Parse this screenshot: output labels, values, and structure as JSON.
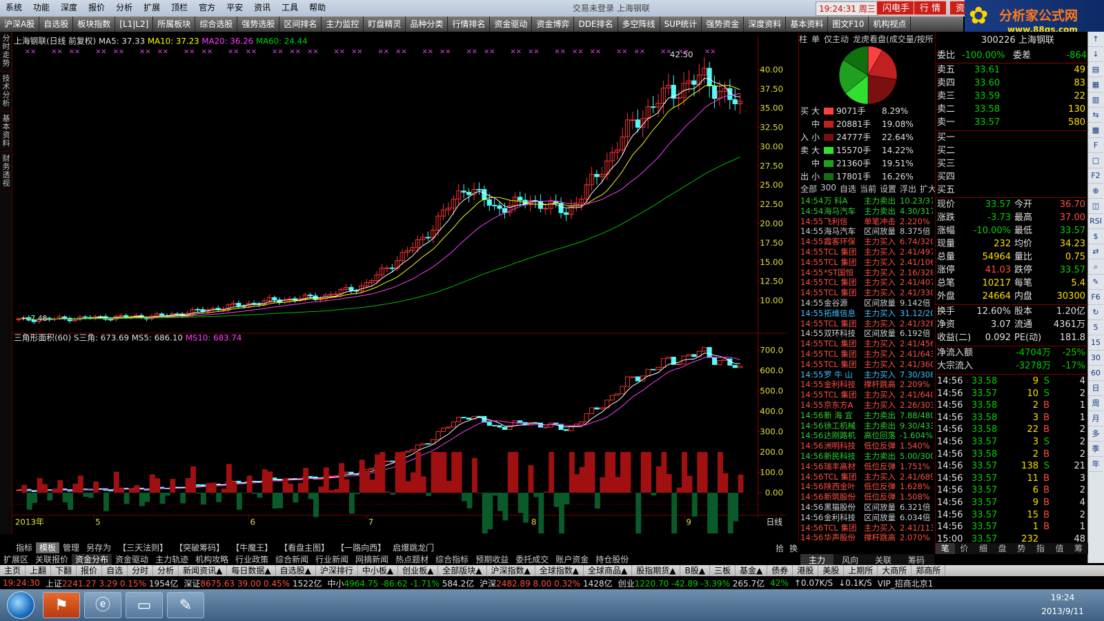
{
  "menu": [
    "系统",
    "功能",
    "深度",
    "报价",
    "分析",
    "扩展",
    "顶栏",
    "官方",
    "平安",
    "资讯",
    "工具",
    "帮助"
  ],
  "window_title": "交易未登录  上海钢联",
  "clock": "19:24:31 周三",
  "top_buttons": [
    "闪电手",
    "行 情",
    "资"
  ],
  "logo": {
    "main": "分析家公式网",
    "url": "www.88gs.com"
  },
  "toolbar": [
    "沪深A股",
    "自选股",
    "板块指数",
    "[L1|L2]",
    "所属板块",
    "综合选股",
    "强势选股",
    "区间排名",
    "主力监控",
    "盯盘精灵",
    "品种分类",
    "行情排名",
    "资金驱动",
    "资金博弈",
    "DDE排名",
    "多空阵线",
    "SUP统计",
    "强势资金",
    "深度资料",
    "基本资料",
    "图文F10",
    "机构视点"
  ],
  "left_tabs": [
    "分时走势",
    "技术分析",
    "基本资料",
    "财务透视"
  ],
  "main_chart": {
    "title": "上海钢联(日线 前复权)",
    "ma5": "MA5: 37.33",
    "ma10": "MA10: 37.23",
    "ma20": "MA20: 36.26",
    "ma60": "MA60: 24.44",
    "peak_label": "42.50",
    "low_label": "7.48",
    "y_ticks": [
      "40.00",
      "37.50",
      "35.00",
      "32.50",
      "30.00",
      "27.50",
      "25.00",
      "22.50",
      "20.00",
      "17.50",
      "15.00",
      "12.50",
      "10.00"
    ]
  },
  "sub_chart": {
    "title": "三角形面积(60)",
    "s": "S三角: 673.69",
    "ms5": "MS5: 686.10",
    "ms10": "MS10: 683.74",
    "y_ticks": [
      "700.0",
      "600.0",
      "500.0",
      "400.0",
      "300.0",
      "200.0",
      "100.0",
      "0.00"
    ]
  },
  "x_axis": {
    "year": "2013年",
    "months": [
      "5",
      "6",
      "7",
      "8",
      "9"
    ],
    "period": "日线"
  },
  "bottom_tabs": [
    "指标",
    "模板",
    "管理",
    "另存为",
    "【三天法则】",
    "【突破筹码】",
    "【牛魔王】",
    "【看盘主图】",
    "【一路向西】",
    "启爆跳龙门"
  ],
  "bottom_controls": [
    "+",
    "-",
    "0"
  ],
  "function_tabs": [
    "扩展区",
    "关联报价",
    "资金分布",
    "资金驱动",
    "主力轨迹",
    "机构攻略",
    "行业政策",
    "综合新闻",
    "行业新闻",
    "网摘新闻",
    "热点题材",
    "综合指标",
    "预期收益",
    "委托成交",
    "账户资金",
    "持仓股份"
  ],
  "panel_tabs_mid": [
    "拾",
    "换"
  ],
  "nav": [
    "主页",
    "上翻",
    "下翻",
    "报价",
    "自选",
    "分时",
    "分析",
    "新闻资讯▲",
    "每日数据▲",
    "自选股▲",
    "沪深排行",
    "中小板▲",
    "创业板▲",
    "全部版块▲",
    "沪深指数▲",
    "全球指数▲",
    "全球商品▲",
    "股指期货▲",
    "B股▲",
    "三板",
    "基金▲",
    "债券",
    "港股",
    "美股",
    "上期所",
    "大商所",
    "郑商所"
  ],
  "index_bar": {
    "time": "19:24:30",
    "sh": {
      "name": "上证",
      "value": "2241.27",
      "chg": "3.29",
      "pct": "0.15%",
      "amt": "1954亿"
    },
    "sz": {
      "name": "深证",
      "value": "8675.63",
      "chg": "39.00",
      "pct": "0.45%",
      "amt": "1522亿"
    },
    "zx": {
      "name": "中小",
      "value": "4964.75",
      "chg": "-86.62",
      "pct": "-1.71%",
      "amt": "584.2亿"
    },
    "hs": {
      "name": "沪深",
      "value": "2482.89",
      "chg": "8.00",
      "pct": "0.32%",
      "amt": "1428亿"
    },
    "cy": {
      "name": "创业",
      "value": "1220.70",
      "chg": "-42.89",
      "pct": "-3.39%",
      "amt": "265.7亿"
    },
    "net": "42%",
    "up": "0.07K/S",
    "down": "0.1K/S",
    "vip": "VIP_招商北京1"
  },
  "taskbar": {
    "time": "19:24",
    "date": "2013/9/11"
  },
  "fund_panel": {
    "tabs": [
      "柱",
      "单",
      "仅主动",
      "龙虎看盘(成交量/按所"
    ],
    "buy_label": [
      "买",
      "入"
    ],
    "sell_label": [
      "卖",
      "出"
    ],
    "buy": [
      [
        "大",
        "9071手",
        "8.29%"
      ],
      [
        "中",
        "20881手",
        "19.08%"
      ],
      [
        "小",
        "24777手",
        "22.64%"
      ]
    ],
    "sell": [
      [
        "大",
        "15570手",
        "14.22%"
      ],
      [
        "中",
        "21360手",
        "19.51%"
      ],
      [
        "小",
        "17801手",
        "16.26%"
      ]
    ],
    "filters": [
      "全部",
      "300",
      "自选",
      "当前",
      "设置",
      "浮出",
      "扩大"
    ],
    "pie": [
      8.29,
      19.08,
      22.64,
      14.22,
      19.51,
      16.26
    ]
  },
  "trades": [
    [
      "14:54",
      "万  科A",
      "主力卖出",
      "10.23/37",
      "g"
    ],
    [
      "14:54",
      "海马汽车",
      "主力卖出",
      "4.30/317",
      "g"
    ],
    [
      "14:55",
      "飞利信",
      "单笔冲击",
      "2.220%",
      "r"
    ],
    [
      "14:55",
      "海马汽车",
      "区间放量",
      "8.375倍",
      "w"
    ],
    [
      "14:55",
      "霞客环保",
      "主力买入",
      "6.74/320",
      "r"
    ],
    [
      "14:55",
      "TCL 集团",
      "主力买入",
      "2.41/497",
      "r"
    ],
    [
      "14:55",
      "TCL 集团",
      "主力买入",
      "2.41/106",
      "r"
    ],
    [
      "14:55",
      "*ST国恒",
      "主力买入",
      "2.16/328",
      "r"
    ],
    [
      "14:55",
      "TCL 集团",
      "主力买入",
      "2.41/407",
      "r"
    ],
    [
      "14:55",
      "TCL 集团",
      "主力买入",
      "2.41/330",
      "r"
    ],
    [
      "14:55",
      "金谷源",
      "区间放量",
      "9.142倍",
      "w"
    ],
    [
      "14:55",
      "拓维信息",
      "主力买入",
      "31.12/20",
      "c"
    ],
    [
      "14:55",
      "TCL 集团",
      "主力买入",
      "2.41/328",
      "r"
    ],
    [
      "14:55",
      "双环科技",
      "区间放量",
      "6.192倍",
      "w"
    ],
    [
      "14:55",
      "TCL 集团",
      "主力买入",
      "2.41/456",
      "r"
    ],
    [
      "14:55",
      "TCL 集团",
      "主力买入",
      "2.41/643",
      "r"
    ],
    [
      "14:55",
      "TCL 集团",
      "主力买入",
      "2.41/360",
      "r"
    ],
    [
      "14:55",
      "罗 牛 山",
      "主力买入",
      "7.30/308",
      "c"
    ],
    [
      "14:55",
      "金利科技",
      "撑杆跳高",
      "2.209%",
      "r"
    ],
    [
      "14:55",
      "TCL 集团",
      "主力买入",
      "2.41/640",
      "r"
    ],
    [
      "14:55",
      "京东方A",
      "主力买入",
      "2.26/303",
      "r"
    ],
    [
      "14:56",
      "新 海 宜",
      "主力卖出",
      "7.88/480",
      "g"
    ],
    [
      "14:56",
      "徐工机械",
      "主力卖出",
      "9.30/433",
      "g"
    ],
    [
      "14:56",
      "达刚路机",
      "高位回落",
      "-1.604%",
      "g"
    ],
    [
      "14:56",
      "洲明科技",
      "低位反弹",
      "1.540%",
      "r"
    ],
    [
      "14:56",
      "新民科技",
      "主力卖出",
      "5.00/300",
      "g"
    ],
    [
      "14:56",
      "瑞丰高材",
      "低位反弹",
      "1.751%",
      "r"
    ],
    [
      "14:56",
      "TCL 集团",
      "主力买入",
      "2.41/689",
      "r"
    ],
    [
      "14:56",
      "陕西金叶",
      "低位反弹",
      "1.628%",
      "r"
    ],
    [
      "14:56",
      "新筑股份",
      "低位反弹",
      "1.508%",
      "r"
    ],
    [
      "14:56",
      "黑猫股份",
      "区间放量",
      "6.321倍",
      "w"
    ],
    [
      "14:56",
      "金利科技",
      "区间放量",
      "6.034倍",
      "w"
    ],
    [
      "14:56",
      "TCL 集团",
      "主力买入",
      "2.41/113",
      "r"
    ],
    [
      "14:56",
      "华声股份",
      "撑杆跳高",
      "2.070%",
      "r"
    ]
  ],
  "trade_panel_tabs": [
    "主力",
    "风向",
    "关联",
    "筹码"
  ],
  "quote": {
    "code": "300226",
    "name": "上海钢联",
    "weibi_label": "委比",
    "weibi": "-100.00%",
    "weicha_label": "委差",
    "weicha": "-864",
    "asks": [
      [
        "卖五",
        "33.61",
        "49"
      ],
      [
        "卖四",
        "33.60",
        "83"
      ],
      [
        "卖三",
        "33.59",
        "22"
      ],
      [
        "卖二",
        "33.58",
        "130"
      ],
      [
        "卖一",
        "33.57",
        "580"
      ]
    ],
    "bids": [
      "买一",
      "买二",
      "买三",
      "买四",
      "买五"
    ],
    "stats": [
      [
        "现价",
        "33.57",
        "今开",
        "36.70"
      ],
      [
        "涨跌",
        "-3.73",
        "最高",
        "37.00"
      ],
      [
        "涨幅",
        "-10.00%",
        "最低",
        "33.57"
      ],
      [
        "现量",
        "232",
        "均价",
        "34.23"
      ],
      [
        "总量",
        "54964",
        "量比",
        "0.75"
      ],
      [
        "涨停",
        "41.03",
        "跌停",
        "33.57"
      ],
      [
        "总笔",
        "10217",
        "每笔",
        "5.4"
      ],
      [
        "外盘",
        "24664",
        "内盘",
        "30300"
      ]
    ],
    "stats2": [
      [
        "换手",
        "12.60%",
        "股本",
        "1.20亿"
      ],
      [
        "净资",
        "3.07",
        "流通",
        "4361万"
      ],
      [
        "收益(二)",
        "0.092",
        "PE(动)",
        "181.8"
      ]
    ],
    "flows": [
      [
        "净流入额",
        "-4704万",
        "-25%"
      ],
      [
        "大宗流入",
        "-3278万",
        "-17%"
      ]
    ],
    "ticks": [
      [
        "14:56",
        "33.58",
        "9",
        "S",
        "4"
      ],
      [
        "14:56",
        "33.57",
        "10",
        "S",
        "2"
      ],
      [
        "14:56",
        "33.58",
        "2",
        "B",
        "1"
      ],
      [
        "14:56",
        "33.58",
        "3",
        "B",
        "1"
      ],
      [
        "14:56",
        "33.58",
        "22",
        "B",
        "2"
      ],
      [
        "14:56",
        "33.57",
        "3",
        "S",
        "2"
      ],
      [
        "14:56",
        "33.58",
        "2",
        "B",
        "2"
      ],
      [
        "14:56",
        "33.57",
        "138",
        "S",
        "21"
      ],
      [
        "14:56",
        "33.57",
        "11",
        "B",
        "3"
      ],
      [
        "14:56",
        "33.57",
        "6",
        "B",
        "2"
      ],
      [
        "14:56",
        "33.57",
        "9",
        "B",
        "4"
      ],
      [
        "14:56",
        "33.57",
        "15",
        "B",
        "2"
      ],
      [
        "14:56",
        "33.57",
        "1",
        "B",
        "1"
      ],
      [
        "15:00",
        "33.57",
        "232",
        "",
        "48"
      ]
    ],
    "bottom_tabs": [
      "笔",
      "价",
      "细",
      "盘",
      "势",
      "指",
      "值",
      "筹"
    ]
  },
  "right_toolbar": [
    "↑",
    "↓",
    "▤",
    "▦",
    "▥",
    "⇆",
    "▩",
    "F",
    "□",
    "F2",
    "⊕",
    "◫",
    "RSI",
    "$",
    "⇄",
    "⌕",
    "✎",
    "F6",
    "↻",
    "5",
    "15",
    "30",
    "60",
    "日",
    "周",
    "月",
    "多",
    "季",
    "年"
  ],
  "colors": {
    "up": "#ff3232",
    "down": "#54fcfc",
    "ma5": "#ffffff",
    "ma10": "#ffff00",
    "ma20": "#ff40ff",
    "ma60": "#00c000",
    "grid": "#800000"
  }
}
